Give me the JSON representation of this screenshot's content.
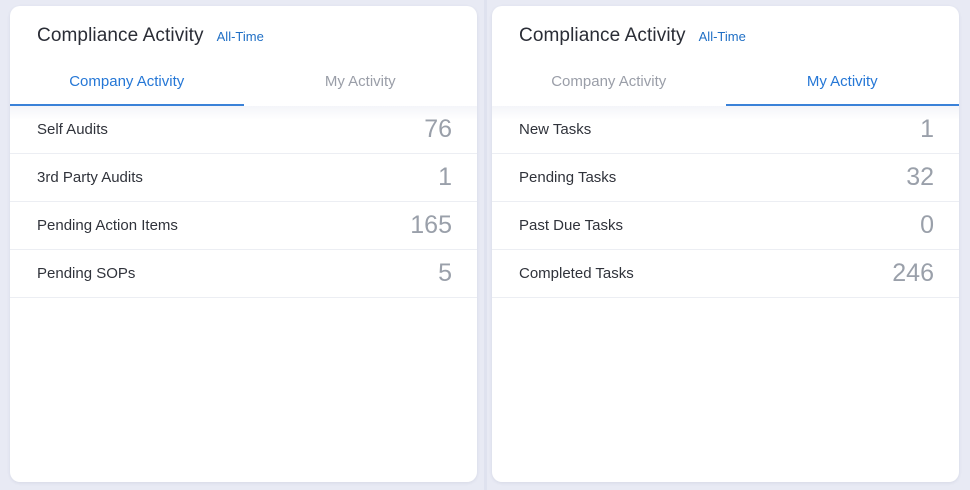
{
  "panels": [
    {
      "title": "Compliance Activity",
      "range_link": "All-Time",
      "tabs": [
        {
          "label": "Company Activity",
          "active": true
        },
        {
          "label": "My Activity",
          "active": false
        }
      ],
      "rows": [
        {
          "label": "Self Audits",
          "value": "76"
        },
        {
          "label": "3rd Party Audits",
          "value": "1"
        },
        {
          "label": "Pending Action Items",
          "value": "165"
        },
        {
          "label": "Pending SOPs",
          "value": "5"
        }
      ]
    },
    {
      "title": "Compliance Activity",
      "range_link": "All-Time",
      "tabs": [
        {
          "label": "Company Activity",
          "active": false
        },
        {
          "label": "My Activity",
          "active": true
        }
      ],
      "rows": [
        {
          "label": "New Tasks",
          "value": "1"
        },
        {
          "label": "Pending Tasks",
          "value": "32"
        },
        {
          "label": "Past Due Tasks",
          "value": "0"
        },
        {
          "label": "Completed Tasks",
          "value": "246"
        }
      ]
    }
  ],
  "colors": {
    "accent": "#2577d6",
    "tab_inactive": "#9a9ea8",
    "value_text": "#9aa0aa",
    "page_background": "#e8eaf4"
  }
}
